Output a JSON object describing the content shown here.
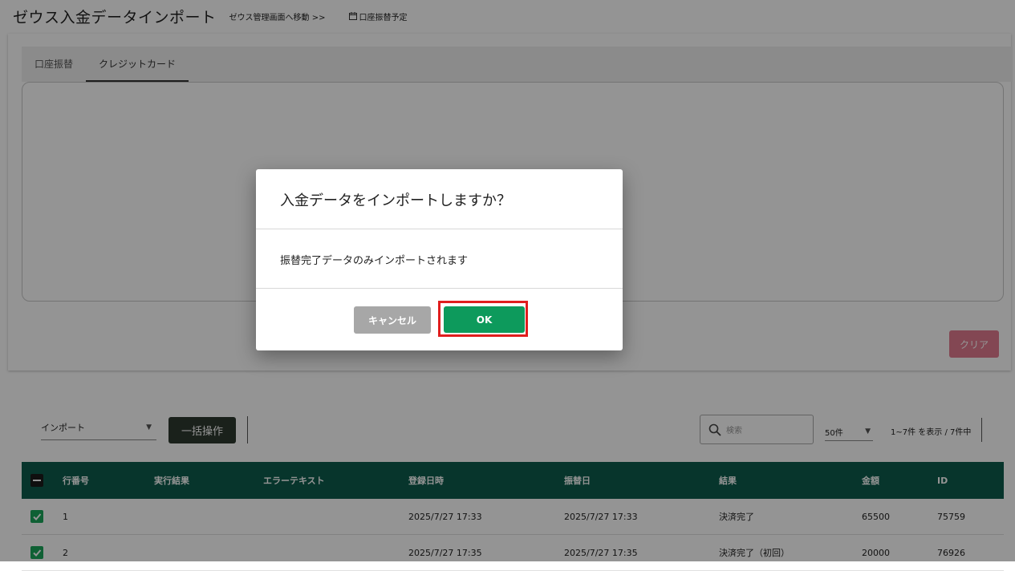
{
  "header": {
    "title": "ゼウス入金データインポート",
    "link_manage": "ゼウス管理画面へ移動 >>",
    "link_schedule": "口座振替予定"
  },
  "tabs": [
    {
      "label": "口座振替"
    },
    {
      "label": "クレジットカード"
    }
  ],
  "upload": {
    "clear_label": "クリア"
  },
  "toolbar": {
    "import_select_value": "インポート",
    "bulk_label": "一括操作",
    "search_placeholder": "検索",
    "per_page_value": "50件",
    "page_info": "1~7件 を表示 / 7件中"
  },
  "table": {
    "headers": [
      "行番号",
      "実行結果",
      "エラーテキスト",
      "登録日時",
      "振替日",
      "結果",
      "金額",
      "ID"
    ],
    "rows": [
      [
        "1",
        "",
        "",
        "2025/7/27 17:33",
        "2025/7/27 17:33",
        "決済完了",
        "65500",
        "75759"
      ],
      [
        "2",
        "",
        "",
        "2025/7/27 17:35",
        "2025/7/27 17:35",
        "決済完了（初回）",
        "20000",
        "76926"
      ]
    ]
  },
  "dialog": {
    "title": "入金データをインポートしますか？",
    "body": "振替完了データのみインポートされます",
    "cancel_label": "キャンセル",
    "ok_label": "OK"
  },
  "colors": {
    "table_header": "#0d5c4c",
    "ok_button": "#0d9a5c",
    "highlight": "#e01e1e",
    "clear_button": "#e27a8f"
  }
}
